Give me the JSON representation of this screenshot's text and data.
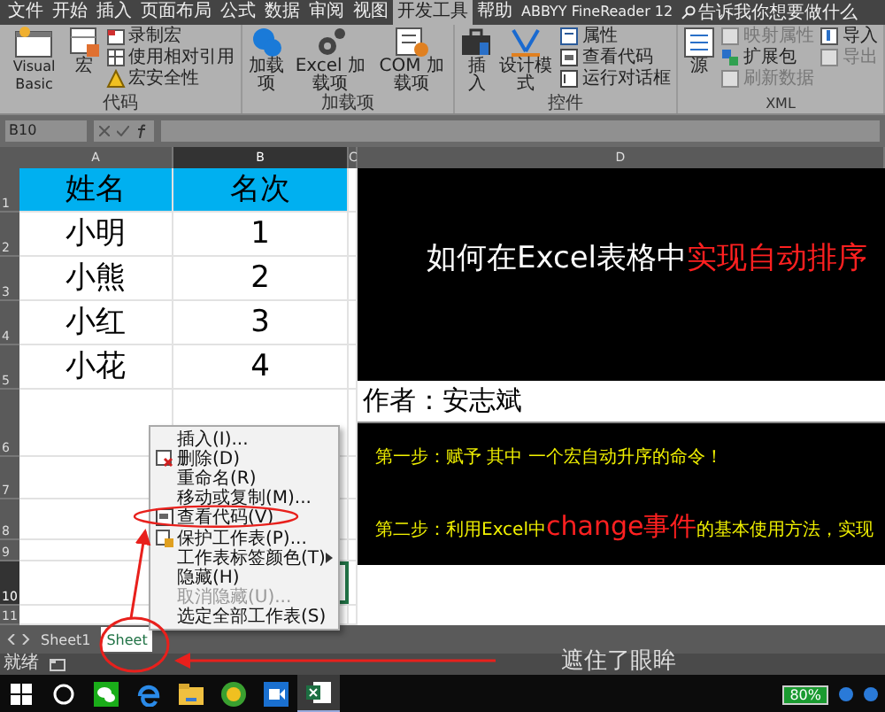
{
  "ribbon_tabs": [
    {
      "label": "文件",
      "selected": false
    },
    {
      "label": "开始",
      "selected": false
    },
    {
      "label": "插入",
      "selected": false
    },
    {
      "label": "页面布局",
      "selected": false
    },
    {
      "label": "公式",
      "selected": false
    },
    {
      "label": "数据",
      "selected": false
    },
    {
      "label": "审阅",
      "selected": false
    },
    {
      "label": "视图",
      "selected": false
    },
    {
      "label": "开发工具",
      "selected": true
    },
    {
      "label": "帮助",
      "selected": false
    },
    {
      "label": "ABBYY FineReader 12",
      "selected": false
    }
  ],
  "tell_me": "告诉我你想要做什么",
  "ribbon_groups": [
    {
      "label": "代码",
      "items": [
        {
          "kind": "large",
          "label": "Visual Basic",
          "disabled": false
        },
        {
          "kind": "large",
          "label": "宏",
          "disabled": false
        },
        {
          "kind": "small",
          "label": "录制宏",
          "disabled": false
        },
        {
          "kind": "small",
          "label": "使用相对引用",
          "disabled": false
        },
        {
          "kind": "small",
          "label": "宏安全性",
          "disabled": false
        }
      ]
    },
    {
      "label": "加载项",
      "items": [
        {
          "kind": "large",
          "label": "加载项",
          "disabled": false
        },
        {
          "kind": "large",
          "label": "Excel 加载项",
          "disabled": false
        },
        {
          "kind": "large",
          "label": "COM 加载项",
          "disabled": false
        }
      ]
    },
    {
      "label": "控件",
      "items": [
        {
          "kind": "large",
          "label": "插入",
          "disabled": false
        },
        {
          "kind": "large",
          "label": "设计模式",
          "disabled": false
        },
        {
          "kind": "small",
          "label": "属性",
          "disabled": false
        },
        {
          "kind": "small",
          "label": "查看代码",
          "disabled": false
        },
        {
          "kind": "small",
          "label": "运行对话框",
          "disabled": false
        }
      ]
    },
    {
      "label": "XML",
      "items": [
        {
          "kind": "large",
          "label": "源",
          "disabled": false
        },
        {
          "kind": "small",
          "label": "映射属性",
          "disabled": true
        },
        {
          "kind": "small",
          "label": "扩展包",
          "disabled": false
        },
        {
          "kind": "small",
          "label": "刷新数据",
          "disabled": true
        },
        {
          "kind": "small",
          "label": "导入",
          "disabled": false
        },
        {
          "kind": "small",
          "label": "导出",
          "disabled": true
        }
      ]
    }
  ],
  "name_box": "B10",
  "columns": [
    {
      "label": "A",
      "selected": false
    },
    {
      "label": "B",
      "selected": true
    },
    {
      "label": "C",
      "selected": false
    },
    {
      "label": "D",
      "selected": false
    }
  ],
  "rows": [
    {
      "label": "1",
      "kind": "header",
      "selected": false,
      "cells": [
        "姓名",
        "名次"
      ]
    },
    {
      "label": "2",
      "kind": "data",
      "selected": false,
      "cells": [
        "小明",
        "1"
      ]
    },
    {
      "label": "3",
      "kind": "data",
      "selected": false,
      "cells": [
        "小熊",
        "2"
      ]
    },
    {
      "label": "4",
      "kind": "data",
      "selected": false,
      "cells": [
        "小红",
        "3"
      ]
    },
    {
      "label": "5",
      "kind": "data",
      "selected": false,
      "cells": [
        "小花",
        "4"
      ]
    },
    {
      "label": "6",
      "kind": "data",
      "selected": false,
      "cells": []
    },
    {
      "label": "7",
      "kind": "data",
      "selected": false,
      "cells": []
    },
    {
      "label": "8",
      "kind": "data",
      "selected": false,
      "cells": []
    },
    {
      "label": "9",
      "kind": "data",
      "selected": false,
      "cells": []
    },
    {
      "label": "10",
      "kind": "data",
      "selected": true,
      "cells": []
    },
    {
      "label": "11",
      "kind": "data",
      "selected": false,
      "cells": []
    }
  ],
  "panel": {
    "title": [
      {
        "text": "如何在Excel表格中",
        "emphasis": false
      },
      {
        "text": "实现自动排序",
        "emphasis": true
      }
    ],
    "author": "作者：安志斌",
    "steps": [
      [
        {
          "text": "第一步：赋予 其中 一个宏自动升序的命令！",
          "emphasis": false
        }
      ],
      [
        {
          "text": "第二步：利用Excel中",
          "emphasis": false
        },
        {
          "text": "change事件",
          "emphasis": true
        },
        {
          "text": "的基本使用方法，实现",
          "emphasis": false
        }
      ]
    ]
  },
  "sheet_tabs": [
    {
      "label": "Sheet1",
      "selected": false
    },
    {
      "label": "Sheet",
      "selected": true
    }
  ],
  "context_menu": [
    {
      "label": "插入(I)...",
      "kind": "plain",
      "disabled": false,
      "submenu": false
    },
    {
      "label": "删除(D)",
      "kind": "delete",
      "disabled": false,
      "submenu": false
    },
    {
      "label": "重命名(R)",
      "kind": "plain",
      "disabled": false,
      "submenu": false
    },
    {
      "label": "移动或复制(M)...",
      "kind": "plain",
      "disabled": false,
      "submenu": false
    },
    {
      "label": "查看代码(V)",
      "kind": "code",
      "disabled": false,
      "submenu": false
    },
    {
      "label": "保护工作表(P)...",
      "kind": "protect",
      "disabled": false,
      "submenu": false
    },
    {
      "label": "工作表标签颜色(T)",
      "kind": "plain",
      "disabled": false,
      "submenu": true
    },
    {
      "label": "隐藏(H)",
      "kind": "plain",
      "disabled": false,
      "submenu": false
    },
    {
      "label": "取消隐藏(U)...",
      "kind": "plain",
      "disabled": true,
      "submenu": false
    },
    {
      "label": "选定全部工作表(S)",
      "kind": "plain",
      "disabled": false,
      "submenu": false
    }
  ],
  "status": "就绪",
  "lyric": "遮住了眼眸",
  "taskbar_apps": [
    {
      "kind": "chat",
      "selected": false
    },
    {
      "kind": "browser",
      "selected": false
    },
    {
      "kind": "folder",
      "selected": false
    },
    {
      "kind": "ball",
      "selected": false
    },
    {
      "kind": "video",
      "selected": false
    },
    {
      "kind": "sheet",
      "selected": true
    }
  ],
  "battery": "80%"
}
